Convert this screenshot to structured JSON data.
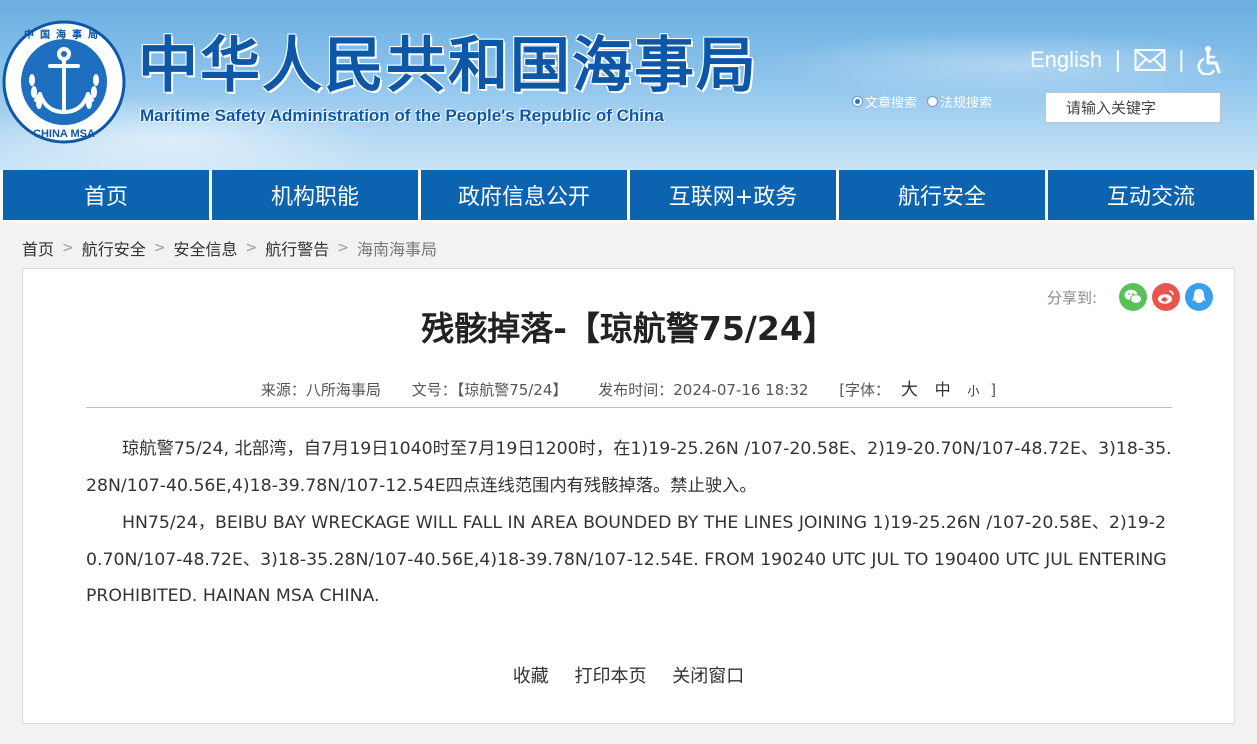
{
  "header": {
    "title_cn": "中华人民共和国海事局",
    "title_en": "Maritime Safety Administration of the People's Republic of China",
    "logo_top_text": "中国海事局",
    "logo_bottom_text": "CHINA MSA",
    "english_link": "English",
    "search": {
      "option_article": "文章搜索",
      "option_law": "法规搜索",
      "placeholder": "请输入关键字"
    }
  },
  "nav": {
    "items": [
      "首页",
      "机构职能",
      "政府信息公开",
      "互联网+政务",
      "航行安全",
      "互动交流"
    ]
  },
  "breadcrumb": [
    "首页",
    "航行安全",
    "安全信息",
    "航行警告",
    "海南海事局"
  ],
  "article": {
    "share_label": "分享到:",
    "title": "残骸掉落-【琼航警75/24】",
    "meta": {
      "source": "来源：八所海事局",
      "doc_no": "文号：【琼航警75/24】",
      "published": "发布时间：2024-07-16 18:32",
      "font_label": "[字体：",
      "font_large": "大",
      "font_medium": "中",
      "font_small": "小",
      "font_end": "]"
    },
    "paragraphs": [
      "琼航警75/24, 北部湾，自7月19日1040时至7月19日1200时，在1)19-25.26N /107-20.58E、2)19-20.70N/107-48.72E、3)18-35.28N/107-40.56E,4)18-39.78N/107-12.54E四点连线范围内有残骸掉落。禁止驶入。",
      "HN75/24，BEIBU BAY  WRECKAGE WILL FALL  IN AREA BOUNDED BY THE LINES JOINING 1)19-25.26N /107-20.58E、2)19-20.70N/107-48.72E、3)18-35.28N/107-40.56E,4)18-39.78N/107-12.54E. FROM 190240 UTC JUL TO 190400 UTC JUL ENTERING PROHIBITED. HAINAN MSA CHINA."
    ],
    "actions": [
      "收藏",
      "打印本页",
      "关闭窗口"
    ]
  },
  "colors": {
    "brand_blue": "#0c63b0",
    "wechat": "#5ac05a",
    "weibo": "#e8554e",
    "qq": "#3aa0ec"
  }
}
